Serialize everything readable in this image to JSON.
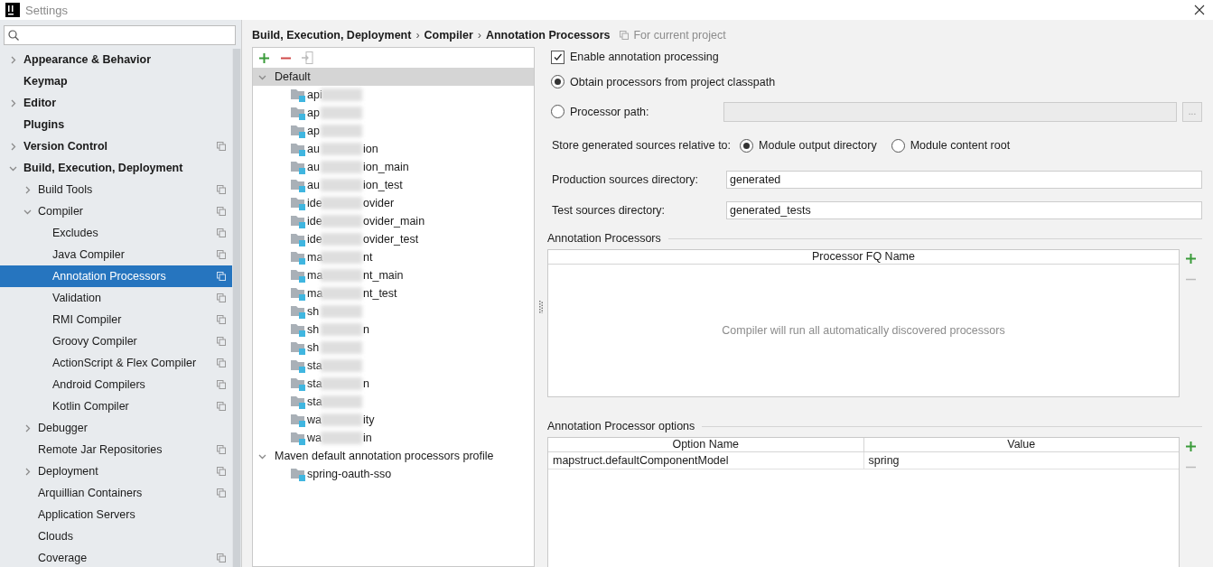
{
  "window": {
    "title": "Settings"
  },
  "sidebar": {
    "items": [
      {
        "label": "Appearance & Behavior",
        "expanded": false,
        "selected": false,
        "project_level": false
      },
      {
        "label": "Keymap",
        "selected": false,
        "project_level": false
      },
      {
        "label": "Editor",
        "expanded": false,
        "selected": false,
        "project_level": false
      },
      {
        "label": "Plugins",
        "selected": false,
        "project_level": false
      },
      {
        "label": "Version Control",
        "expanded": false,
        "selected": false,
        "project_level": true
      },
      {
        "label": "Build, Execution, Deployment",
        "expanded": true,
        "selected": false,
        "project_level": false,
        "children": [
          {
            "label": "Build Tools",
            "expanded": false,
            "selected": false,
            "project_level": true
          },
          {
            "label": "Compiler",
            "expanded": true,
            "selected": false,
            "project_level": true,
            "children": [
              {
                "label": "Excludes",
                "selected": false,
                "project_level": true
              },
              {
                "label": "Java Compiler",
                "selected": false,
                "project_level": true
              },
              {
                "label": "Annotation Processors",
                "selected": true,
                "project_level": true
              },
              {
                "label": "Validation",
                "selected": false,
                "project_level": true
              },
              {
                "label": "RMI Compiler",
                "selected": false,
                "project_level": true
              },
              {
                "label": "Groovy Compiler",
                "selected": false,
                "project_level": true
              },
              {
                "label": "ActionScript & Flex Compiler",
                "selected": false,
                "project_level": true
              },
              {
                "label": "Android Compilers",
                "selected": false,
                "project_level": true
              },
              {
                "label": "Kotlin Compiler",
                "selected": false,
                "project_level": true
              }
            ]
          },
          {
            "label": "Debugger",
            "expanded": false,
            "selected": false,
            "project_level": false
          },
          {
            "label": "Remote Jar Repositories",
            "selected": false,
            "project_level": true
          },
          {
            "label": "Deployment",
            "expanded": false,
            "selected": false,
            "project_level": true
          },
          {
            "label": "Arquillian Containers",
            "selected": false,
            "project_level": true
          },
          {
            "label": "Application Servers",
            "selected": false,
            "project_level": false
          },
          {
            "label": "Clouds",
            "selected": false,
            "project_level": false
          },
          {
            "label": "Coverage",
            "selected": false,
            "project_level": true
          }
        ]
      }
    ]
  },
  "breadcrumb": {
    "path": [
      "Build, Execution, Deployment",
      "Compiler",
      "Annotation Processors"
    ],
    "separator": "›",
    "scope": "For current project"
  },
  "profiles": {
    "groups": [
      {
        "name": "Default",
        "expanded": true,
        "selected": true,
        "modules": [
          {
            "prefix": "api",
            "blurred": true
          },
          {
            "prefix": "ap",
            "blurred": true
          },
          {
            "prefix": "ap",
            "blurred": true
          },
          {
            "prefix": "au",
            "blurred": true,
            "suffix": "ion"
          },
          {
            "prefix": "au",
            "blurred": true,
            "suffix": "ion_main"
          },
          {
            "prefix": "au",
            "blurred": true,
            "suffix": "ion_test"
          },
          {
            "prefix": "ide",
            "blurred": true,
            "suffix": "ovider"
          },
          {
            "prefix": "ide",
            "blurred": true,
            "suffix": "ovider_main"
          },
          {
            "prefix": "ide",
            "blurred": true,
            "suffix": "ovider_test"
          },
          {
            "prefix": "ma",
            "blurred": true,
            "suffix": "nt"
          },
          {
            "prefix": "ma",
            "blurred": true,
            "suffix": "nt_main"
          },
          {
            "prefix": "ma",
            "blurred": true,
            "suffix": "nt_test"
          },
          {
            "prefix": "sh",
            "blurred": true
          },
          {
            "prefix": "sh",
            "blurred": true,
            "suffix": "n"
          },
          {
            "prefix": "sh",
            "blurred": true
          },
          {
            "prefix": "sta",
            "blurred": true
          },
          {
            "prefix": "sta",
            "blurred": true,
            "suffix": "n"
          },
          {
            "prefix": "sta",
            "blurred": true
          },
          {
            "prefix": "wa",
            "blurred": true,
            "suffix": "ity"
          },
          {
            "prefix": "wa",
            "blurred": true,
            "suffix": "in"
          }
        ]
      },
      {
        "name": "Maven default annotation processors profile",
        "expanded": true,
        "selected": false,
        "modules": [
          {
            "prefix": "spring-oauth-sso",
            "blurred": false
          }
        ]
      }
    ]
  },
  "settings": {
    "enable": {
      "label": "Enable annotation processing",
      "checked": true
    },
    "sources": [
      {
        "kind": "plain",
        "label": "Obtain processors from project classpath",
        "selected": true
      },
      {
        "kind": "path",
        "label": "Processor path:",
        "selected": false,
        "disabled": true,
        "browse": "..."
      }
    ],
    "store": {
      "label": "Store generated sources relative to:",
      "options": [
        {
          "label": "Module output directory",
          "selected": true
        },
        {
          "label": "Module content root",
          "selected": false
        }
      ]
    },
    "fields": [
      {
        "label": "Production sources directory:",
        "value": "generated"
      },
      {
        "label": "Test sources directory:",
        "value": "generated_tests"
      }
    ],
    "processors": {
      "title": "Annotation Processors",
      "columns": [
        "Processor FQ Name"
      ],
      "empty_text": "Compiler will run all automatically discovered processors"
    },
    "options": {
      "title": "Annotation Processor options",
      "columns": [
        "Option Name",
        "Value"
      ],
      "rows": [
        [
          "mapstruct.defaultComponentModel",
          "spring"
        ]
      ]
    }
  }
}
